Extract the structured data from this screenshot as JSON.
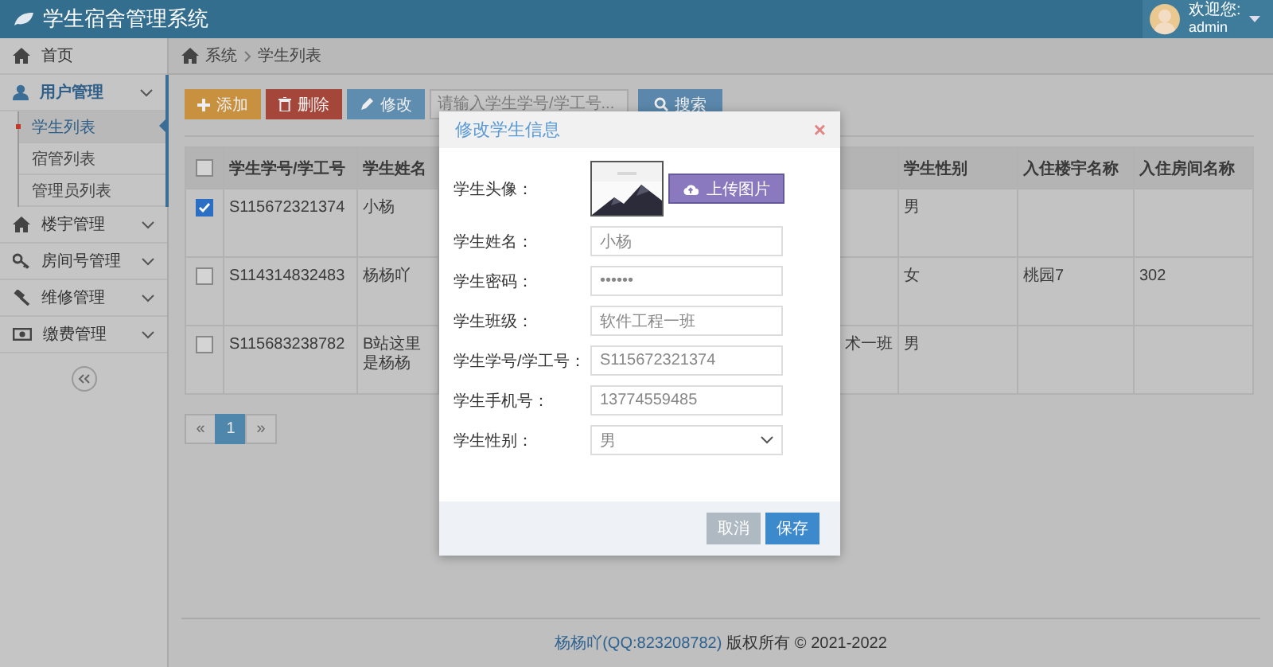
{
  "header": {
    "title": "学生宿舍管理系统",
    "user_greeting": "欢迎您:",
    "user_name": "admin"
  },
  "sidebar": {
    "items": [
      {
        "label": "首页",
        "kind": "link"
      },
      {
        "label": "用户管理",
        "kind": "group",
        "expanded": true,
        "children": [
          {
            "label": "学生列表",
            "selected": true
          },
          {
            "label": "宿管列表",
            "selected": false
          },
          {
            "label": "管理员列表",
            "selected": false
          }
        ]
      },
      {
        "label": "楼宇管理",
        "kind": "group",
        "expanded": false
      },
      {
        "label": "房间号管理",
        "kind": "group",
        "expanded": false
      },
      {
        "label": "维修管理",
        "kind": "group",
        "expanded": false
      },
      {
        "label": "缴费管理",
        "kind": "group",
        "expanded": false
      }
    ]
  },
  "breadcrumb": [
    "系统",
    "学生列表"
  ],
  "toolbar": {
    "buttons": [
      {
        "label": "添加",
        "kind": "add"
      },
      {
        "label": "删除",
        "kind": "delete"
      },
      {
        "label": "修改",
        "kind": "edit"
      }
    ],
    "search": {
      "placeholder": "请输入学生学号/学工号...",
      "button": "搜索"
    }
  },
  "table": {
    "select_all": {
      "checked": false
    },
    "columns": [
      "学生学号/学工号",
      "学生姓名",
      "学生性别",
      "入住楼宇名称",
      "入住房间名称"
    ],
    "rows": [
      {
        "checked": true,
        "id": "S115672321374",
        "name": "小杨",
        "gender": "男"
      },
      {
        "checked": false,
        "id": "S114314832483",
        "name": "杨杨吖",
        "gender": "女",
        "building": "桃园7",
        "room": "302"
      },
      {
        "checked": false,
        "id": "S115683238782",
        "name": "B站这里是杨杨",
        "column_4": "术一班",
        "gender": "男"
      }
    ]
  },
  "pagination": {
    "prev": "«",
    "pages": [
      {
        "label": "1",
        "selected": true
      }
    ],
    "next": "»"
  },
  "footer": {
    "link": "杨杨吖(QQ:823208782)",
    "text": "版权所有 © 2021-2022"
  },
  "modal": {
    "title": "修改学生信息",
    "close": "×",
    "avatar": {
      "label": "学生头像：",
      "kind": "picture",
      "upload_button": "上传图片"
    },
    "fields": [
      {
        "label": "学生姓名：",
        "value": "小杨",
        "kind": "text"
      },
      {
        "label": "学生密码：",
        "value": "••••••",
        "kind": "text"
      },
      {
        "label": "学生班级：",
        "value": "软件工程一班",
        "kind": "text"
      },
      {
        "label": "学生学号/学工号：",
        "value": "S115672321374",
        "kind": "text"
      },
      {
        "label": "学生手机号：",
        "value": "13774559485",
        "kind": "text"
      },
      {
        "label": "学生性别：",
        "value": "男",
        "kind": "select"
      }
    ],
    "buttons": [
      {
        "label": "取消",
        "kind": "cancel"
      },
      {
        "label": "保存",
        "kind": "primary"
      }
    ]
  }
}
